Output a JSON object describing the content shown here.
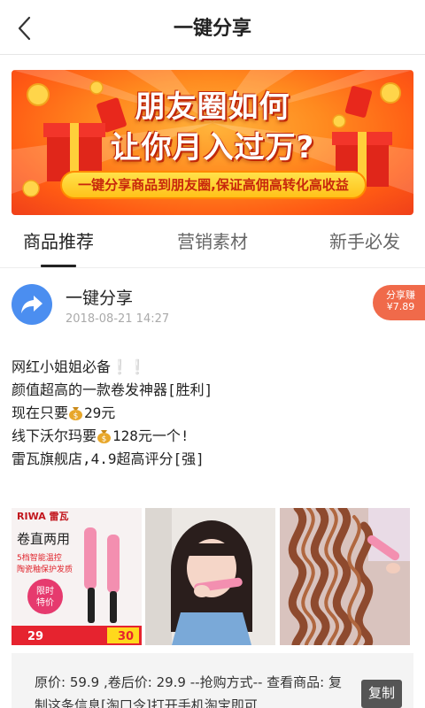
{
  "header": {
    "title": "一键分享"
  },
  "banner": {
    "line1": "朋友圈如何",
    "line2": "让你月入过万?",
    "slogan": "一键分享商品到朋友圈,保证高佣高转化高收益"
  },
  "tabs": [
    {
      "label": "商品推荐",
      "active": true
    },
    {
      "label": "营销素材",
      "active": false
    },
    {
      "label": "新手必发",
      "active": false
    }
  ],
  "post": {
    "author": "一键分享",
    "time": "2018-08-21 14:27",
    "earn_label": "分享赚",
    "earn_value": "¥7.89",
    "lines": {
      "l1": "网红小姐姐必备",
      "l1_suffix": "❕❕",
      "l2": "颜值超高的一款卷发神器[胜利]",
      "l3_pre": "现在只要",
      "l3_post": "29元",
      "l4_pre": "线下沃尔玛要",
      "l4_post": "128元一个!",
      "l5": "雷瓦旗舰店,4.9超高评分[强]"
    },
    "images": {
      "img1": {
        "brand": "RIWA 雷瓦",
        "tag": "卷直两用",
        "feature1": "5档智能温控",
        "feature2": "陶瓷釉保护发质",
        "promo1": "限时",
        "promo2": "特价",
        "price_left": "29",
        "price_right": "30"
      }
    }
  },
  "info": {
    "text": "原价: 59.9 ,卷后价: 29.9 --抢购方式-- 查看商品: 复制这条信息[淘口令]打开手机淘宝即可"
  },
  "copy_button": "复制",
  "colors": {
    "badge": "#f06a4a",
    "avatar": "#4b8ef0",
    "banner_orange": "#ff7a1f"
  }
}
